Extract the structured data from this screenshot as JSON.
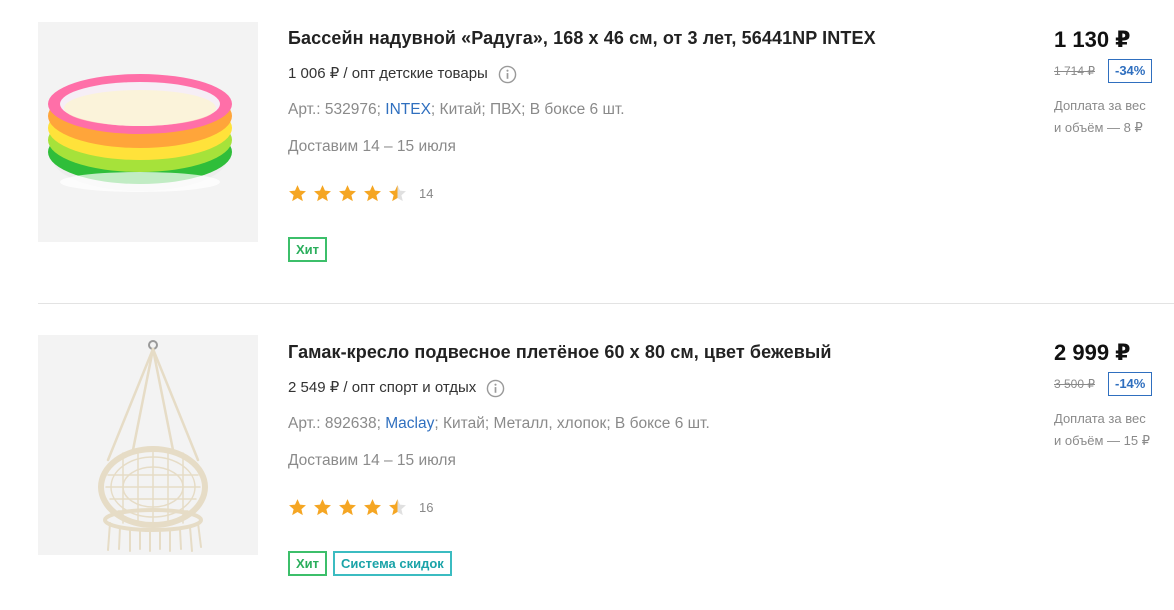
{
  "products": [
    {
      "title": "Бассейн надувной «Радуга», 168 х 46 см, от 3 лет, 56441NP INTEX",
      "wholesale": "1 006 ₽ / опт детские товары",
      "art_prefix": "Арт.: 532976;",
      "brand": "INTEX",
      "meta_rest": "; Китай; ПВХ; В боксе 6 шт.",
      "delivery": "Доставим 14 – 15 июля",
      "rating": 4.5,
      "reviews": "14",
      "badges": [
        "Хит"
      ],
      "price": "1 130 ₽",
      "old_price": "1 714 ₽",
      "discount": "-34%",
      "surcharge_line1": "Доплата за вес",
      "surcharge_line2": "и объём — 8 ₽",
      "image_icon": "inflatable-pool-image"
    },
    {
      "title": "Гамак-кресло подвесное плетёное 60 х 80 см, цвет бежевый",
      "wholesale": "2 549 ₽ / опт спорт и отдых",
      "art_prefix": "Арт.: 892638;",
      "brand": "Maclay",
      "meta_rest": "; Китай; Металл, хлопок; В боксе 6 шт.",
      "delivery": "Доставим 14 – 15 июля",
      "rating": 4.5,
      "reviews": "16",
      "badges": [
        "Хит",
        "Система скидок"
      ],
      "price": "2 999 ₽",
      "old_price": "3 500 ₽",
      "discount": "-14%",
      "surcharge_line1": "Доплата за вес",
      "surcharge_line2": "и объём — 15 ₽",
      "image_icon": "hammock-chair-image"
    }
  ],
  "colors": {
    "star": "#f5a623",
    "brand_link": "#2f6fbf",
    "badge_hit": "#3cbf6a",
    "badge_discount": "#3bbcc1"
  }
}
